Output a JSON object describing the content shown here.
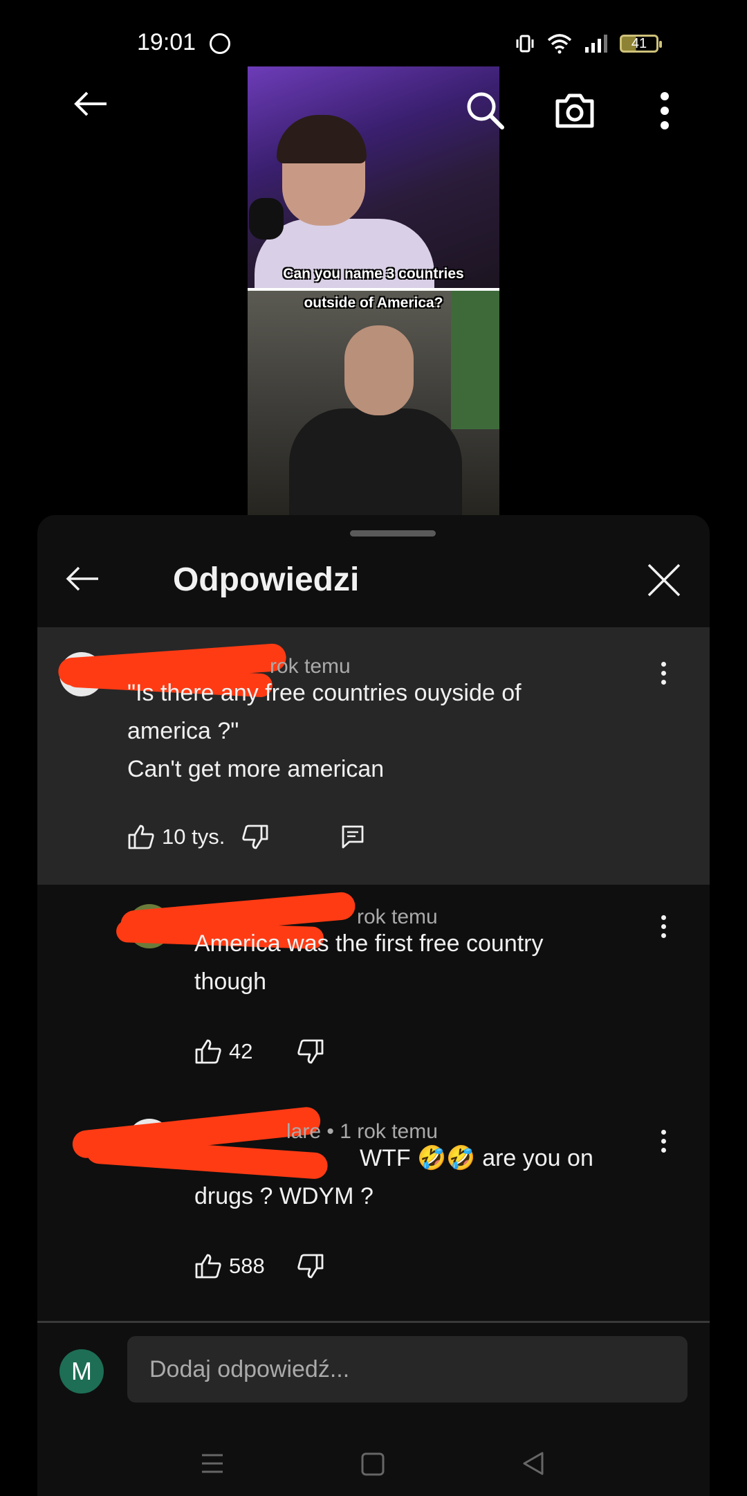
{
  "status_bar": {
    "time": "19:01",
    "battery": "41",
    "icons": [
      "accessibility-icon",
      "vibrate-icon",
      "wifi-icon",
      "signal-icon",
      "battery-icon"
    ]
  },
  "video": {
    "caption_line1": "Can you name 3 countries",
    "caption_line2": "outside of America?"
  },
  "toolbar": {
    "icons": [
      "back-arrow-icon",
      "search-icon",
      "camera-icon",
      "more-vert-icon"
    ]
  },
  "sheet": {
    "title": "Odpowiedzi"
  },
  "comments": [
    {
      "meta": "rok temu",
      "text_line1": "\"Is there any free countries ouyside of",
      "text_line2": "america ?\"",
      "text_line3": "Can't get more american",
      "likes": "10 tys."
    },
    {
      "meta": "rok temu",
      "text_line1": "America was the first free country",
      "text_line2": "though",
      "likes": "42"
    },
    {
      "meta": "lare • 1 rok temu",
      "text_line1": "WTF 🤣🤣 are you on",
      "text_line2": "drugs ? WDYM ?",
      "likes": "588"
    }
  ],
  "composer": {
    "avatar_letter": "M",
    "placeholder": "Dodaj odpowiedź..."
  },
  "colors": {
    "sheet_bg": "#0f0f0f",
    "highlight_bg": "#272727",
    "redaction": "#ff3b14",
    "avatar_bg": "#1d6e55"
  }
}
